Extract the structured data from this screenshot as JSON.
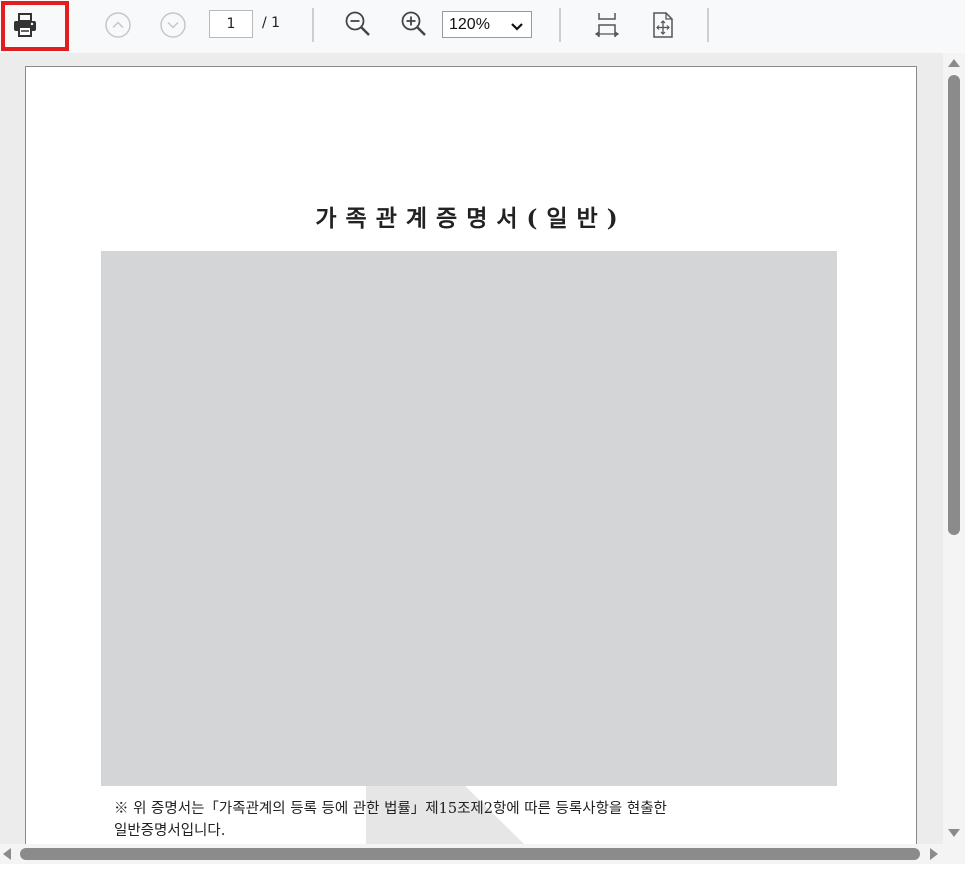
{
  "toolbar": {
    "page_current": "1",
    "page_separator": "/ 1",
    "zoom": "120%",
    "icons": [
      "print-icon",
      "previous-page-icon",
      "next-page-icon",
      "zoom-out-icon",
      "zoom-in-icon",
      "fit-width-icon",
      "fit-page-icon"
    ],
    "highlight_color": "#e11d1d"
  },
  "document": {
    "title": "가족관계증명서(일반)",
    "note_line1": "※ 위 증명서는「가족관계의 등록 등에 관한 법률」제15조제2항에 따른 등록사항을 현출한",
    "note_line2": "일반증명서입니다."
  }
}
